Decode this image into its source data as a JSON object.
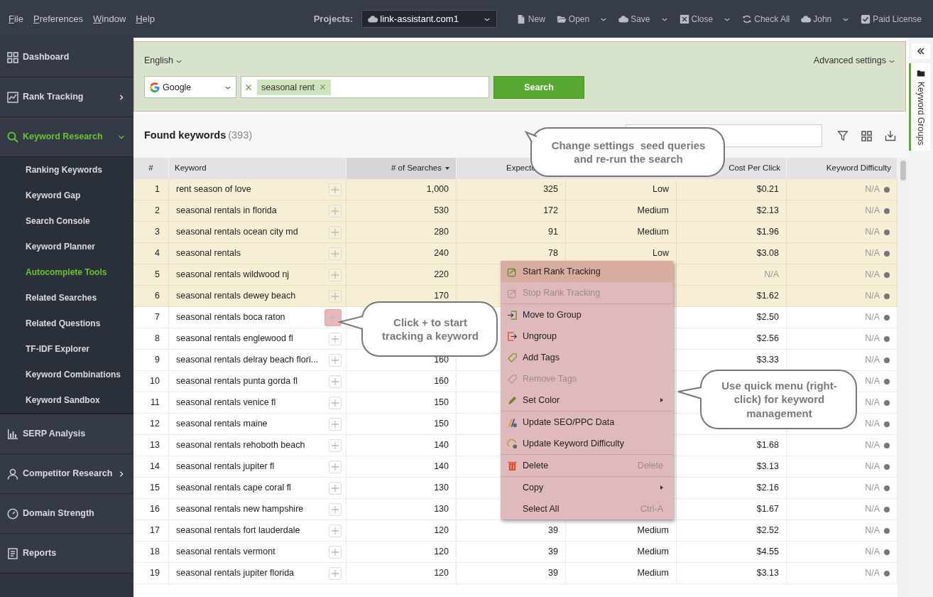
{
  "menu_bar": [
    "File",
    "Preferences",
    "Window",
    "Help"
  ],
  "projects": {
    "label": "Projects:",
    "value": "link-assistant.com1"
  },
  "toolbar": [
    {
      "label": "New",
      "dropdown": false
    },
    {
      "label": "Open",
      "dropdown": true
    },
    {
      "label": "Save",
      "dropdown": true
    },
    {
      "label": "Close",
      "dropdown": true
    },
    {
      "label": "Check All",
      "dropdown": false
    },
    {
      "label": "John",
      "dropdown": true
    },
    {
      "label": "Paid License",
      "dropdown": false
    }
  ],
  "sidebar": {
    "items": [
      {
        "label": "Dashboard",
        "selected": false
      },
      {
        "label": "Rank Tracking",
        "selected": false,
        "expanded": false
      },
      {
        "label": "Keyword Research",
        "selected": true,
        "expanded": true,
        "children": [
          {
            "label": "Ranking Keywords",
            "selected": false
          },
          {
            "label": "Keyword Gap",
            "selected": false
          },
          {
            "label": "Search Console",
            "selected": false
          },
          {
            "label": "Keyword Planner",
            "selected": false
          },
          {
            "label": "Autocomplete Tools",
            "selected": true
          },
          {
            "label": "Related Searches",
            "selected": false
          },
          {
            "label": "Related Questions",
            "selected": false
          },
          {
            "label": "TF-IDF Explorer",
            "selected": false
          },
          {
            "label": "Keyword Combinations",
            "selected": false
          },
          {
            "label": "Keyword Sandbox",
            "selected": false
          }
        ]
      },
      {
        "label": "SERP Analysis",
        "selected": false
      },
      {
        "label": "Competitor Research",
        "selected": false,
        "expanded": false
      },
      {
        "label": "Domain Strength",
        "selected": false
      },
      {
        "label": "Reports",
        "selected": false
      }
    ]
  },
  "search_panel": {
    "language": "English",
    "advanced": "Advanced settings",
    "engine": "Google",
    "tags": [
      "seasonal rent"
    ],
    "button": "Search"
  },
  "results": {
    "title": "Found keywords",
    "count": "(393)"
  },
  "table": {
    "columns": [
      {
        "label": "#",
        "sorted": false
      },
      {
        "label": "Keyword",
        "sorted": false
      },
      {
        "label": "# of Searches",
        "sorted": true
      },
      {
        "label": "Expecte",
        "sorted": false
      },
      {
        "sorted": false
      },
      {
        "label": "Cost Per Click",
        "sorted": false
      },
      {
        "label": "Keyword Difficulty",
        "sorted": false
      }
    ],
    "rows": [
      {
        "num": "1",
        "keyword": "rent season of love",
        "searches": "1,000",
        "expected": "325",
        "competition": "Low",
        "cpc": "$0.21",
        "difficulty": "N/A",
        "selected": true,
        "add_highlighted": false,
        "cpc_muted": false
      },
      {
        "num": "2",
        "keyword": "seasonal rentals in florida",
        "searches": "530",
        "expected": "172",
        "competition": "Medium",
        "cpc": "$2.13",
        "difficulty": "N/A",
        "selected": true,
        "add_highlighted": false,
        "cpc_muted": false
      },
      {
        "num": "3",
        "keyword": "seasonal rentals ocean city md",
        "searches": "280",
        "expected": "91",
        "competition": "Medium",
        "cpc": "$1.96",
        "difficulty": "N/A",
        "selected": true,
        "add_highlighted": false,
        "cpc_muted": false
      },
      {
        "num": "4",
        "keyword": "seasonal rentals",
        "searches": "240",
        "expected": "78",
        "competition": "Low",
        "cpc": "$3.08",
        "difficulty": "N/A",
        "selected": true,
        "add_highlighted": false,
        "cpc_muted": false
      },
      {
        "num": "5",
        "keyword": "seasonal rentals wildwood nj",
        "searches": "220",
        "cpc": "N/A",
        "difficulty": "N/A",
        "selected": true,
        "add_highlighted": false,
        "cpc_muted": true
      },
      {
        "num": "6",
        "keyword": "seasonal rentals dewey beach",
        "searches": "170",
        "cpc": "$1.62",
        "difficulty": "N/A",
        "selected": true,
        "add_highlighted": false,
        "cpc_muted": false
      },
      {
        "num": "7",
        "keyword": "seasonal rentals boca raton",
        "cpc": "$2.50",
        "difficulty": "N/A",
        "selected": false,
        "add_highlighted": true,
        "cpc_muted": false
      },
      {
        "num": "8",
        "keyword": "seasonal rentals englewood fl",
        "cpc": "$2.56",
        "difficulty": "N/A",
        "selected": false,
        "add_highlighted": false,
        "cpc_muted": false
      },
      {
        "num": "9",
        "keyword": "seasonal rentals delray beach flori...",
        "searches": "160",
        "cpc": "$3.33",
        "difficulty": "N/A",
        "selected": false,
        "add_highlighted": false,
        "cpc_muted": false
      },
      {
        "num": "10",
        "keyword": "seasonal rentals punta gorda fl",
        "searches": "160",
        "difficulty": "N/A",
        "selected": false,
        "add_highlighted": false,
        "cpc_muted": false
      },
      {
        "num": "11",
        "keyword": "seasonal rentals venice fl",
        "searches": "150",
        "difficulty": "N/A",
        "selected": false,
        "add_highlighted": false,
        "cpc_muted": false
      },
      {
        "num": "12",
        "keyword": "seasonal rentals maine",
        "searches": "150",
        "difficulty": "N/A",
        "selected": false,
        "add_highlighted": false,
        "cpc_muted": false
      },
      {
        "num": "13",
        "keyword": "seasonal rentals rehoboth beach",
        "searches": "140",
        "cpc": "$1.68",
        "difficulty": "N/A",
        "selected": false,
        "add_highlighted": false,
        "cpc_muted": false
      },
      {
        "num": "14",
        "keyword": "seasonal rentals jupiter fl",
        "searches": "140",
        "cpc": "$3.13",
        "difficulty": "N/A",
        "selected": false,
        "add_highlighted": false,
        "cpc_muted": false
      },
      {
        "num": "15",
        "keyword": "seasonal rentals cape coral fl",
        "searches": "130",
        "cpc": "$2.16",
        "difficulty": "N/A",
        "selected": false,
        "add_highlighted": false,
        "cpc_muted": false
      },
      {
        "num": "16",
        "keyword": "seasonal rentals new hampshire",
        "searches": "130",
        "cpc": "$1.67",
        "difficulty": "N/A",
        "selected": false,
        "add_highlighted": false,
        "cpc_muted": false
      },
      {
        "num": "17",
        "keyword": "seasonal rentals fort lauderdale",
        "searches": "120",
        "expected": "39",
        "competition": "Medium",
        "cpc": "$2.52",
        "difficulty": "N/A",
        "selected": false,
        "add_highlighted": false,
        "cpc_muted": false
      },
      {
        "num": "18",
        "keyword": "seasonal rentals vermont",
        "searches": "120",
        "expected": "39",
        "competition": "Medium",
        "cpc": "$4.55",
        "difficulty": "N/A",
        "selected": false,
        "add_highlighted": false,
        "cpc_muted": false
      },
      {
        "num": "19",
        "keyword": "seasonal rentals jupiter florida",
        "searches": "120",
        "expected": "39",
        "competition": "Medium",
        "cpc": "$3.13",
        "difficulty": "N/A",
        "selected": false,
        "add_highlighted": false,
        "cpc_muted": false
      }
    ]
  },
  "context_menu": {
    "items": [
      {
        "kind": "item",
        "label": "Start Rank Tracking",
        "selected": true,
        "disabled": false,
        "submenu": false
      },
      {
        "kind": "item",
        "label": "Stop Rank Tracking",
        "selected": false,
        "disabled": true,
        "submenu": false
      },
      {
        "kind": "separator"
      },
      {
        "kind": "item",
        "label": "Move to Group",
        "selected": false,
        "disabled": false,
        "submenu": false
      },
      {
        "kind": "item",
        "label": "Ungroup",
        "selected": false,
        "disabled": false,
        "submenu": false
      },
      {
        "kind": "item",
        "label": "Add Tags",
        "selected": false,
        "disabled": false,
        "submenu": false
      },
      {
        "kind": "item",
        "label": "Remove Tags",
        "selected": false,
        "disabled": true,
        "submenu": false
      },
      {
        "kind": "item",
        "label": "Set Color",
        "selected": false,
        "disabled": false,
        "submenu": true
      },
      {
        "kind": "separator"
      },
      {
        "kind": "item",
        "label": "Update SEO/PPC Data",
        "selected": false,
        "disabled": false,
        "submenu": false
      },
      {
        "kind": "item",
        "label": "Update Keyword Difficulty",
        "selected": false,
        "disabled": false,
        "submenu": false
      },
      {
        "kind": "separator"
      },
      {
        "kind": "item",
        "label": "Delete",
        "shortcut": "Delete",
        "selected": false,
        "disabled": false,
        "submenu": false
      },
      {
        "kind": "separator"
      },
      {
        "kind": "item",
        "label": "Copy",
        "selected": false,
        "disabled": false,
        "submenu": true
      },
      {
        "kind": "item",
        "label": "Select All",
        "shortcut": "Ctrl-A",
        "selected": false,
        "disabled": false,
        "submenu": false
      }
    ]
  },
  "callouts": [
    {
      "text": "Change settings  seed queries and re-run the search"
    },
    {
      "text": "Click + to start tracking a keyword"
    },
    {
      "text": "Use quick menu (right-click) for keyword management"
    }
  ],
  "right_panel": {
    "tab": "Keyword Groups",
    "selected": true
  }
}
